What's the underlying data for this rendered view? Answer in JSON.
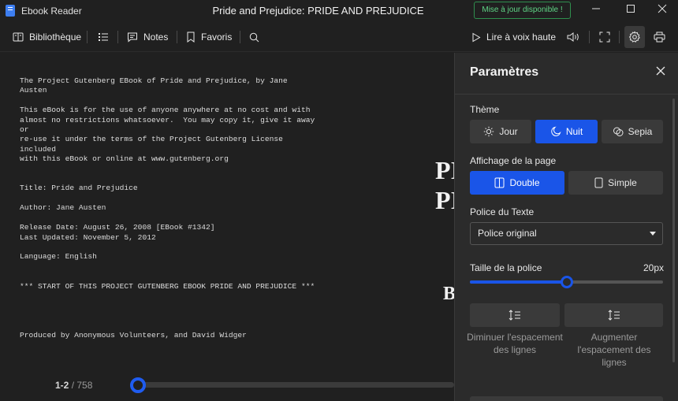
{
  "window": {
    "app_title": "Ebook Reader",
    "doc_title": "Pride and Prejudice: PRIDE AND PREJUDICE",
    "update_badge": "Mise à jour disponible !"
  },
  "toolbar": {
    "library_label": "Bibliothèque",
    "notes_label": "Notes",
    "bookmarks_label": "Favoris",
    "read_aloud_label": "Lire à voix haute"
  },
  "reader": {
    "text": "The Project Gutenberg EBook of Pride and Prejudice, by Jane\nAusten\n\nThis eBook is for the use of anyone anywhere at no cost and with\nalmost no restrictions whatsoever.  You may copy it, give it away\nor\nre-use it under the terms of the Project Gutenberg License\nincluded\nwith this eBook or online at www.gutenberg.org\n\n\nTitle: Pride and Prejudice\n\nAuthor: Jane Austen\n\nRelease Date: August 26, 2008 [EBook #1342]\nLast Updated: November 5, 2012\n\nLanguage: English\n\n\n*** START OF THIS PROJECT GUTENBERG EBOOK PRIDE AND PREJUDICE ***\n\n\n\n\nProduced by Anonymous Volunteers, and David Widger",
    "right_page_line1": "PI",
    "right_page_line2": "PI",
    "right_page_line3": "B",
    "page_current": "1-2",
    "page_separator": "/",
    "page_total": "758",
    "progress_fraction": 0.0
  },
  "settings": {
    "title": "Paramètres",
    "theme_label": "Thème",
    "theme_options": [
      "Jour",
      "Nuit",
      "Sepia"
    ],
    "theme_selected": "Nuit",
    "page_display_label": "Affichage de la page",
    "page_display_options": [
      "Double",
      "Simple"
    ],
    "page_display_selected": "Double",
    "font_label": "Police du Texte",
    "font_value": "Police original",
    "font_size_label": "Taille de la police",
    "font_size_value": "20px",
    "font_size_fraction": 0.5,
    "decrease_spacing_label": "Diminuer l'espacement des lignes",
    "increase_spacing_label": "Augmenter l'espacement des lignes"
  },
  "colors": {
    "accent": "#1a55e8",
    "update_green": "#5fd485",
    "background": "#202020",
    "panel": "#2b2b2b"
  }
}
